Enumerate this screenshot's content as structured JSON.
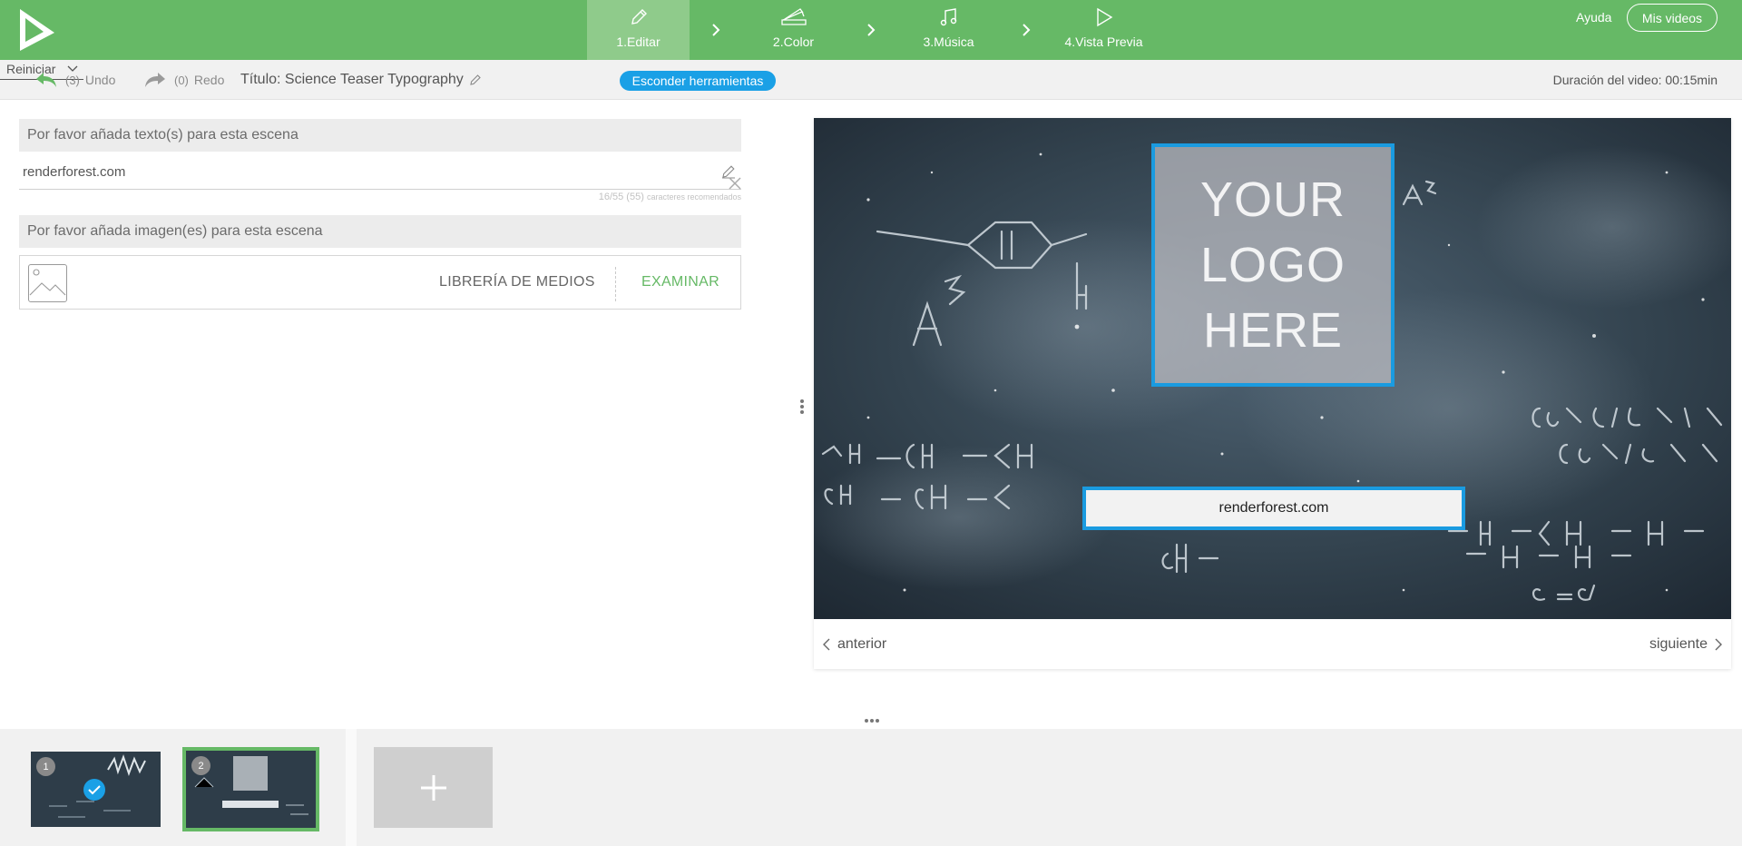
{
  "topbar": {
    "steps": [
      {
        "label": "1.Editar",
        "icon": "pencil-icon",
        "active": true
      },
      {
        "label": "2.Color",
        "icon": "color-swatch-icon",
        "active": false
      },
      {
        "label": "3.Música",
        "icon": "music-note-icon",
        "active": false
      },
      {
        "label": "4.Vista Previa",
        "icon": "play-icon",
        "active": false
      }
    ],
    "help_label": "Ayuda",
    "my_videos_label": "Mis videos"
  },
  "toolbar": {
    "undo_count": "(3)",
    "undo_label": "Undo",
    "redo_count": "(0)",
    "redo_label": "Redo",
    "title": "Título: Science Teaser Typography",
    "reset_label": "Reiniciar",
    "hide_tools_label": "Esconder herramientas",
    "duration": "Duración del video: 00:15min"
  },
  "editor": {
    "texts_header": "Por favor añada texto(s) para esta escena",
    "text_value": "renderforest.com",
    "char_count": "16/55 (55)",
    "char_hint": "caracteres recomendados",
    "images_header": "Por favor añada imagen(es) para esta escena",
    "media_library_label": "LIBRERÍA DE MEDIOS",
    "browse_label": "EXAMINAR"
  },
  "preview": {
    "logo_lines": [
      "YOUR",
      "LOGO",
      "HERE"
    ],
    "text": "renderforest.com",
    "prev_label": "anterior",
    "next_label": "siguiente"
  },
  "scenes": [
    {
      "number": "1",
      "selected": false,
      "checked": true
    },
    {
      "number": "2",
      "selected": true,
      "checked": false
    }
  ],
  "colors": {
    "brand_green": "#66b966",
    "active_step": "#8fcb8b",
    "accent_blue": "#1aa0e6",
    "chalkboard": "#2b3b48"
  }
}
